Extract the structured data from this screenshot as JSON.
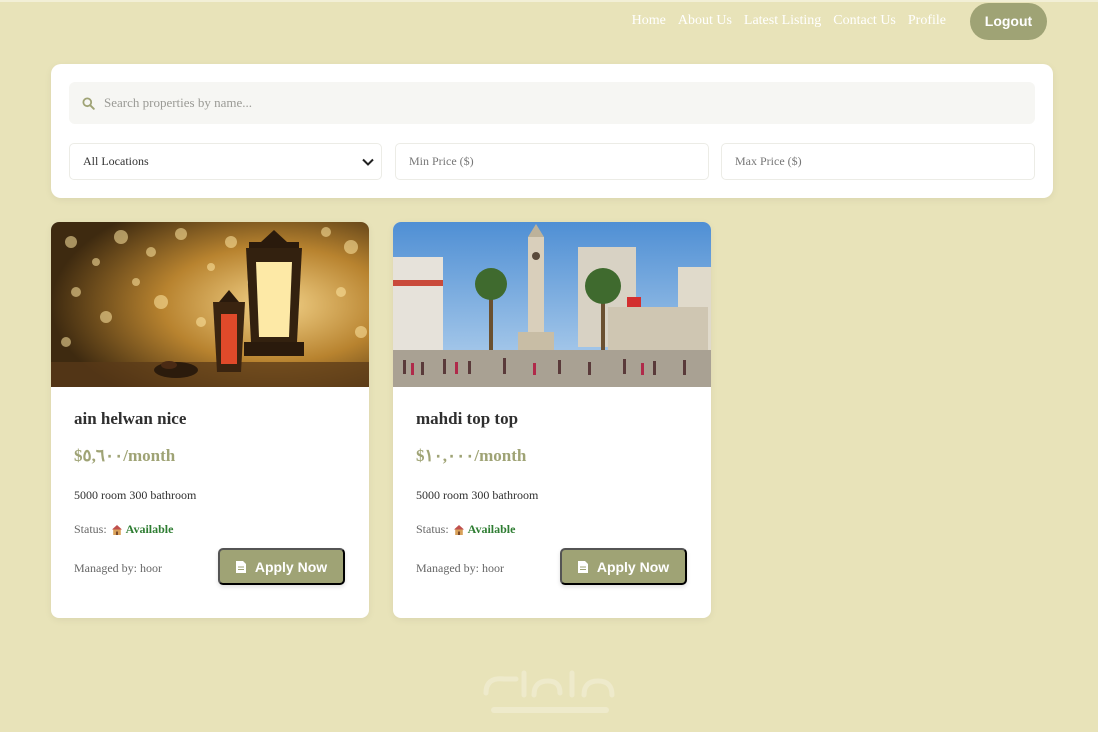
{
  "nav": {
    "links": [
      "Home",
      "About Us",
      "Latest Listing",
      "Contact Us",
      "Profile"
    ],
    "logout_label": "Logout"
  },
  "search": {
    "placeholder": "Search properties by name...",
    "location_selected": "All Locations",
    "min_price_placeholder": "Min Price ($)",
    "max_price_placeholder": "Max Price ($)"
  },
  "cards": [
    {
      "title": "ain helwan nice",
      "price": "$٥,٦٠٠/month",
      "specs": "5000 room 300 bathroom",
      "status_label": "Status:",
      "status_value": "Available",
      "manager": "Managed by: hoor",
      "apply_label": "Apply Now"
    },
    {
      "title": "mahdi top top",
      "price": "$١٠,٠٠٠/month",
      "specs": "5000 room 300 bathroom",
      "status_label": "Status:",
      "status_value": "Available",
      "manager": "Managed by: hoor",
      "apply_label": "Apply Now"
    }
  ],
  "colors": {
    "background": "#e8e3b9",
    "accent": "#9fa375",
    "available": "#2e7d32"
  },
  "icons": [
    "search-icon",
    "chevron-down-icon",
    "house-icon",
    "document-icon"
  ]
}
